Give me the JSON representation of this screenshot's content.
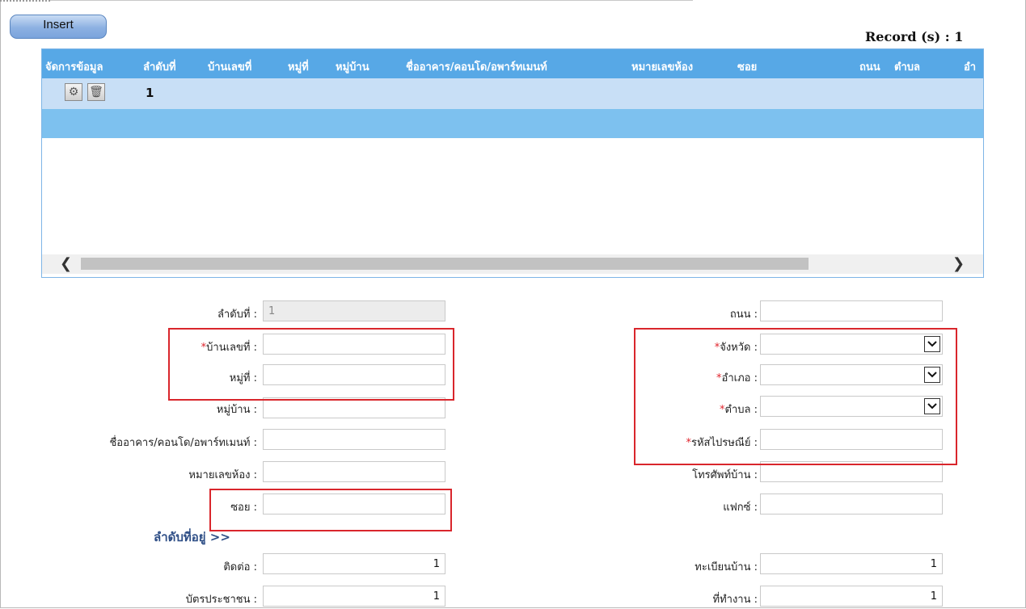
{
  "toolbar": {
    "insert_label": "Insert"
  },
  "grid": {
    "record_count": "Record (s) : 1",
    "columns": [
      "จัดการข้อมูล",
      "ลำดับที่",
      "บ้านเลขที่",
      "หมู่ที่",
      "หมู่บ้าน",
      "ชื่ออาคาร/คอนโด/อพาร์ทเมนท์",
      "หมายเลขห้อง",
      "ซอย",
      "ถนน",
      "ตำบล",
      "อำ"
    ],
    "rows": [
      {
        "order": "1",
        "house_no": "",
        "soi": "",
        "tambon": ""
      }
    ]
  },
  "form": {
    "order": {
      "label": "ลำดับที่ :",
      "value": "1"
    },
    "house_no": {
      "label": "บ้านเลขที่ :",
      "value": ""
    },
    "moo": {
      "label": "หมู่ที่ :",
      "value": ""
    },
    "village": {
      "label": "หมู่บ้าน :",
      "value": ""
    },
    "building": {
      "label": "ชื่ออาคาร/คอนโด/อพาร์ทเมนท์ :",
      "value": ""
    },
    "room": {
      "label": "หมายเลขห้อง :",
      "value": ""
    },
    "soi": {
      "label": "ซอย :",
      "value": ""
    },
    "road": {
      "label": "ถนน :",
      "value": ""
    },
    "province": {
      "label": "จังหวัด :",
      "value": ""
    },
    "district": {
      "label": "อำเภอ :",
      "value": ""
    },
    "subdistrict": {
      "label": "ตำบล :",
      "value": ""
    },
    "postcode": {
      "label": "รหัสไปรษณีย์ :",
      "value": ""
    },
    "home_phone": {
      "label": "โทรศัพท์บ้าน :",
      "value": ""
    },
    "fax": {
      "label": "แฟกซ์ :",
      "value": ""
    },
    "required_mark": "*",
    "section_title": "ลำดับที่อยู่ >>",
    "contact": {
      "label": "ติดต่อ :",
      "value": "1"
    },
    "house_registration": {
      "label": "ทะเบียนบ้าน :",
      "value": "1"
    },
    "id_card": {
      "label": "บัตรประชาชน :",
      "value": "1"
    },
    "workplace": {
      "label": "ที่ทำงาน :",
      "value": "1"
    }
  },
  "colors": {
    "header": "#57a8e6",
    "selected_row": "#c8dff6",
    "highlight_box": "#d9262c",
    "required": "#e0242c",
    "section_title": "#2e4e86"
  }
}
